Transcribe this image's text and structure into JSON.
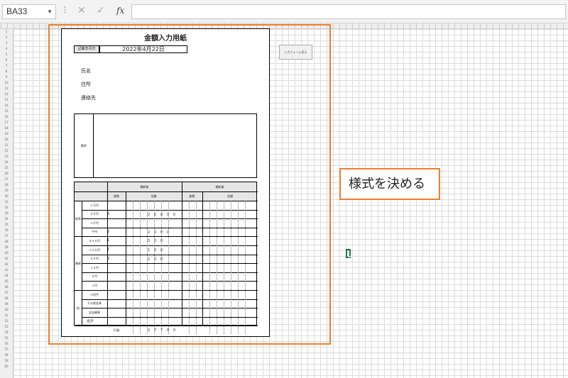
{
  "formula_bar": {
    "name_box": "BA33",
    "cancel_glyph": "✕",
    "enter_glyph": "✓",
    "fx_label": "fx",
    "formula": ""
  },
  "form": {
    "title": "金額入力用紙",
    "date_label": "記載年月日",
    "date_value": "2022年4月22日",
    "name_label": "氏名",
    "address_label": "住所",
    "contact_label": "連絡先",
    "memo_label": "備考",
    "table": {
      "group_before": "棚卸前",
      "group_after": "棚卸後",
      "col_count": "枚数",
      "col_amount": "金額",
      "section_bills": "紙幣",
      "section_coins": "硬貨",
      "section_other": "他",
      "rows": [
        {
          "label": "１万円",
          "count": "",
          "amount": ""
        },
        {
          "label": "５千円",
          "count": "5",
          "amount": "２５０００"
        },
        {
          "label": "２千円",
          "count": "",
          "amount": ""
        },
        {
          "label": "千円",
          "count": "2",
          "amount": "２０００"
        },
        {
          "label": "５００円",
          "count": "1",
          "amount": "５００"
        },
        {
          "label": "１００円",
          "count": "1",
          "amount": "１００"
        },
        {
          "label": "５０円",
          "count": "2",
          "amount": "１００"
        },
        {
          "label": "１０円",
          "count": "",
          "amount": ""
        },
        {
          "label": "５円",
          "count": "",
          "amount": ""
        },
        {
          "label": "１円",
          "count": "",
          "amount": ""
        },
        {
          "label": "小切手",
          "count": "",
          "amount": ""
        },
        {
          "label": "その他金券",
          "count": "",
          "amount": ""
        },
        {
          "label": "記念硬貨",
          "count": "",
          "amount": ""
        },
        {
          "label": "",
          "count": "",
          "amount": ""
        }
      ],
      "total_label": "合計",
      "total_count": "11枚",
      "total_amount": "２７７００"
    }
  },
  "form_button_label": "入力フォーム表示",
  "callout_text": "様式を決める",
  "colors": {
    "accent_orange": "#f07d2d",
    "excel_green": "#217346"
  }
}
